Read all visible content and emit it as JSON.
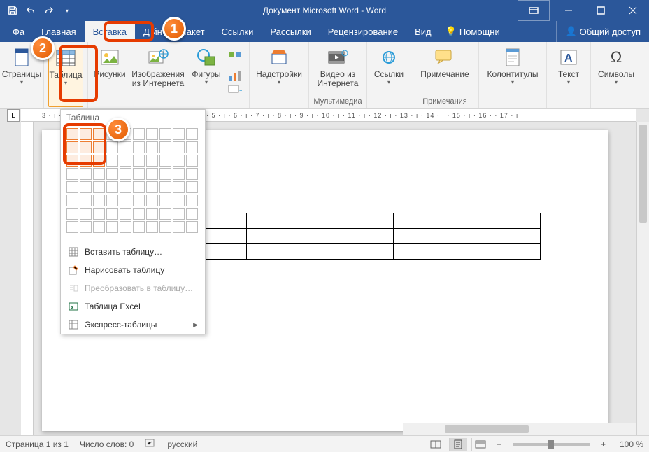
{
  "title": "Документ Microsoft Word - Word",
  "tabs": {
    "file": "Фа",
    "home": "Главная",
    "insert": "Вставка",
    "design": "Д     йн",
    "layout": "Макет",
    "references": "Ссылки",
    "mailings": "Рассылки",
    "review": "Рецензирование",
    "view": "Вид"
  },
  "tell_me": "Помощни",
  "share": "Общий доступ",
  "ribbon": {
    "pages": "Страницы",
    "table": "Таблица",
    "pictures": "Рисунки",
    "online_pictures_l1": "Изображения",
    "online_pictures_l2": "из Интернета",
    "shapes": "Фигуры",
    "addins": "Надстройки",
    "video_l1": "Видео из",
    "video_l2": "Интернета",
    "media_group": "Мультимедиа",
    "links": "Ссылки",
    "comment": "Примечание",
    "comments_group": "Примечания",
    "headerfooter": "Колонтитулы",
    "text": "Текст",
    "symbols": "Символы"
  },
  "dropdown": {
    "title": "Таблица",
    "insert_table": "Вставить таблицу…",
    "draw_table": "Нарисовать таблицу",
    "convert": "Преобразовать в таблицу…",
    "excel": "Таблица Excel",
    "quick": "Экспресс-таблицы"
  },
  "ruler": "3 · ı · 2 · ı · 1 · ı ·   · ı · 1 · ı · 2 · ı · 3 · ı · 4 · ı · 5 · ı · 6 · ı · 7 · ı · 8 · ı · 9 · ı · 10 · ı · 11 · ı · 12 · ı · 13 · ı · 14 · ı · 15 · ı · 16 ·   · 17 · ı",
  "status": {
    "page": "Страница 1 из 1",
    "words": "Число слов: 0",
    "lang": "русский",
    "zoom": "100 %"
  },
  "callouts": {
    "c1": "1",
    "c2": "2",
    "c3": "3"
  },
  "grid_selection": {
    "cols": 3,
    "rows": 3
  }
}
